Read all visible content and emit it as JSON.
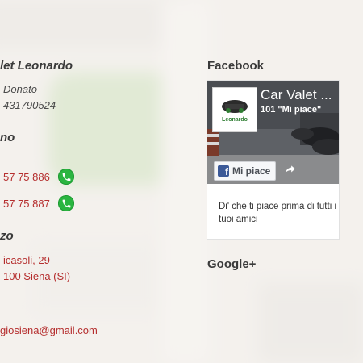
{
  "contact": {
    "name_heading": "let Leonardo",
    "address_line1": "Donato",
    "vat_line": "431790524",
    "phone_heading": "no",
    "phone1": "57 75 886",
    "phone2": "57 75 887",
    "address_heading": "zo",
    "street": "icasoli, 29",
    "city": "100 Siena (SI)",
    "email": "giosiena@gmail.com"
  },
  "facebook": {
    "heading": "Facebook",
    "page_name": "Car Valet ...",
    "likes": "101 \"Mi piace\"",
    "like_button": "Mi piace",
    "cta": "Di' che ti piace prima di tutti i tuoi amici",
    "logo_text": "Leonardo"
  },
  "google": {
    "heading": "Google+"
  },
  "colors": {
    "accent_red": "#b52e2e",
    "whatsapp_green": "#2ab540",
    "facebook_blue": "#3b5998"
  }
}
